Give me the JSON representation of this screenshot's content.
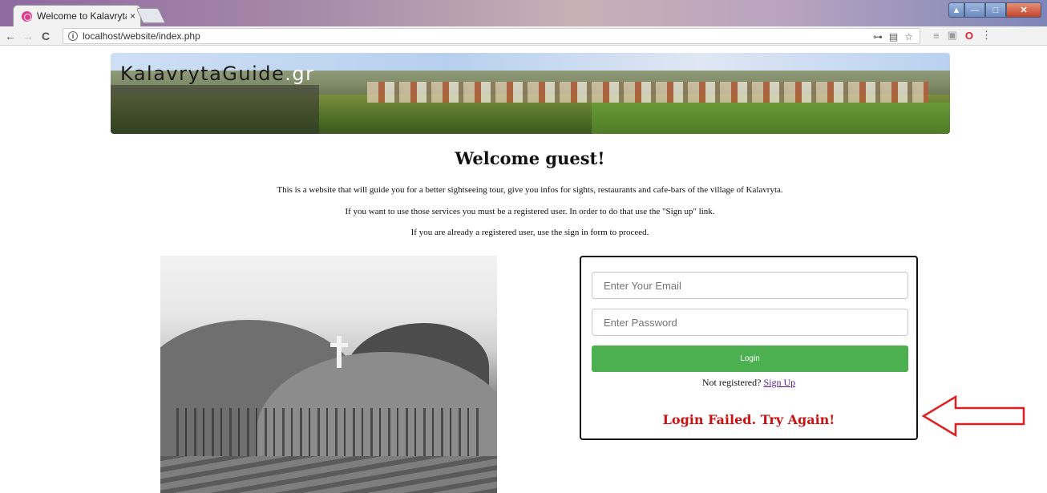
{
  "browser": {
    "tab_title": "Welcome to KalavrytaGu",
    "tab_close": "×",
    "url": "localhost/website/index.php",
    "back": "←",
    "forward": "→",
    "reload": "C"
  },
  "banner": {
    "logo_main": "KalavrytaGuide",
    "logo_tld": ".gr"
  },
  "page": {
    "welcome": "Welcome guest!",
    "intro_1": "This is a website that will guide you for a better sightseeing tour, give you infos for sights, restaurants and cafe-bars of the village of Kalavryta.",
    "intro_2": "If you want to use those services you must be a registered user. In order to do that use the \"Sign up\" link.",
    "intro_3": "If you are already a registered user, use the sign in form to proceed."
  },
  "login": {
    "email_placeholder": "Enter Your Email",
    "password_placeholder": "Enter Password",
    "button_label": "Login",
    "not_registered": "Not registered?",
    "signup_link": "Sign Up",
    "error_message": "Login Failed. Try Again!"
  },
  "colors": {
    "login_button": "#4caf50",
    "error_text": "#cc1111",
    "arrow": "#e02020"
  }
}
